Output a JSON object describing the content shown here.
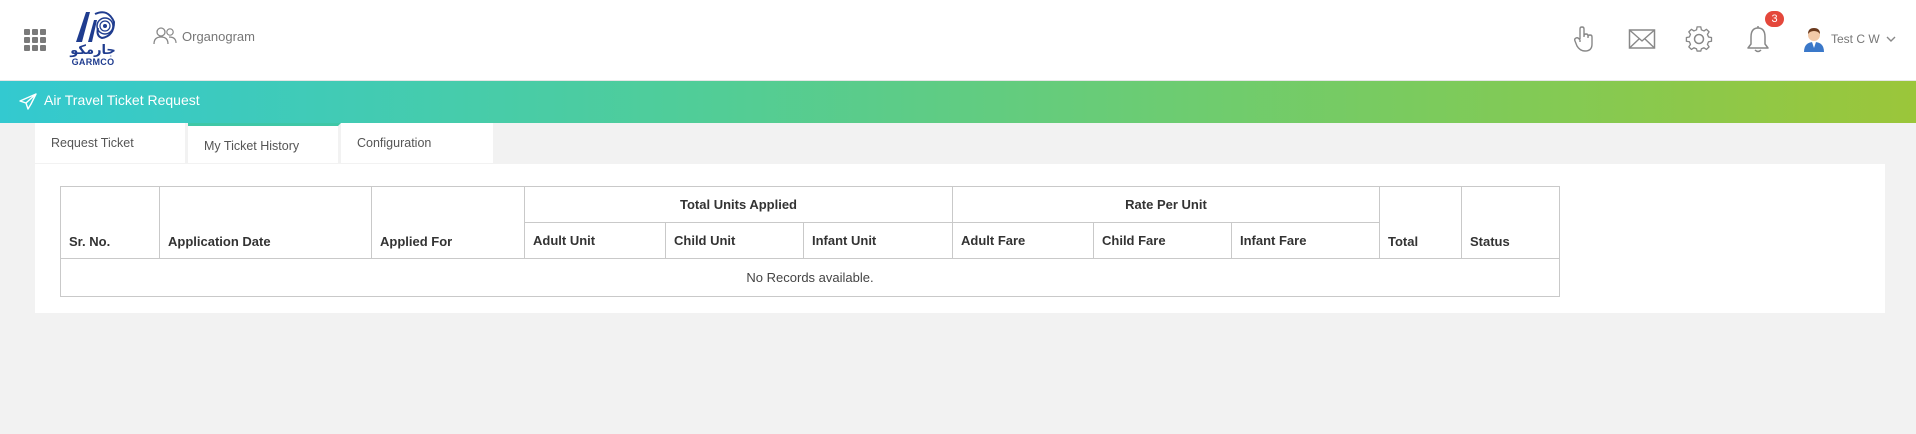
{
  "header": {
    "logo": {
      "arabic": "جارمكو",
      "name": "GARMCO"
    },
    "organogram_label": "Organogram",
    "notification_count": "3",
    "user_name": "Test C W",
    "icons": [
      "grid-apps-icon",
      "hand-pointer-icon",
      "mail-icon",
      "gear-icon",
      "bell-icon",
      "user-avatar",
      "chevron-down-icon"
    ]
  },
  "banner": {
    "title": "Air Travel Ticket Request",
    "colors": [
      "#33c9d0",
      "#9bc63a"
    ]
  },
  "tabs": [
    {
      "label": "Request Ticket",
      "active": false
    },
    {
      "label": "My Ticket History",
      "active": true
    },
    {
      "label": "Configuration",
      "active": false
    }
  ],
  "table": {
    "groups": {
      "units": "Total Units Applied",
      "rate": "Rate Per Unit"
    },
    "columns": {
      "sr_no": "Sr. No.",
      "application_date": "Application Date",
      "applied_for": "Applied For",
      "adult_unit": "Adult Unit",
      "child_unit": "Child Unit",
      "infant_unit": "Infant Unit",
      "adult_fare": "Adult Fare",
      "child_fare": "Child Fare",
      "infant_fare": "Infant Fare",
      "total": "Total",
      "status": "Status"
    },
    "empty_message": "No Records available."
  }
}
